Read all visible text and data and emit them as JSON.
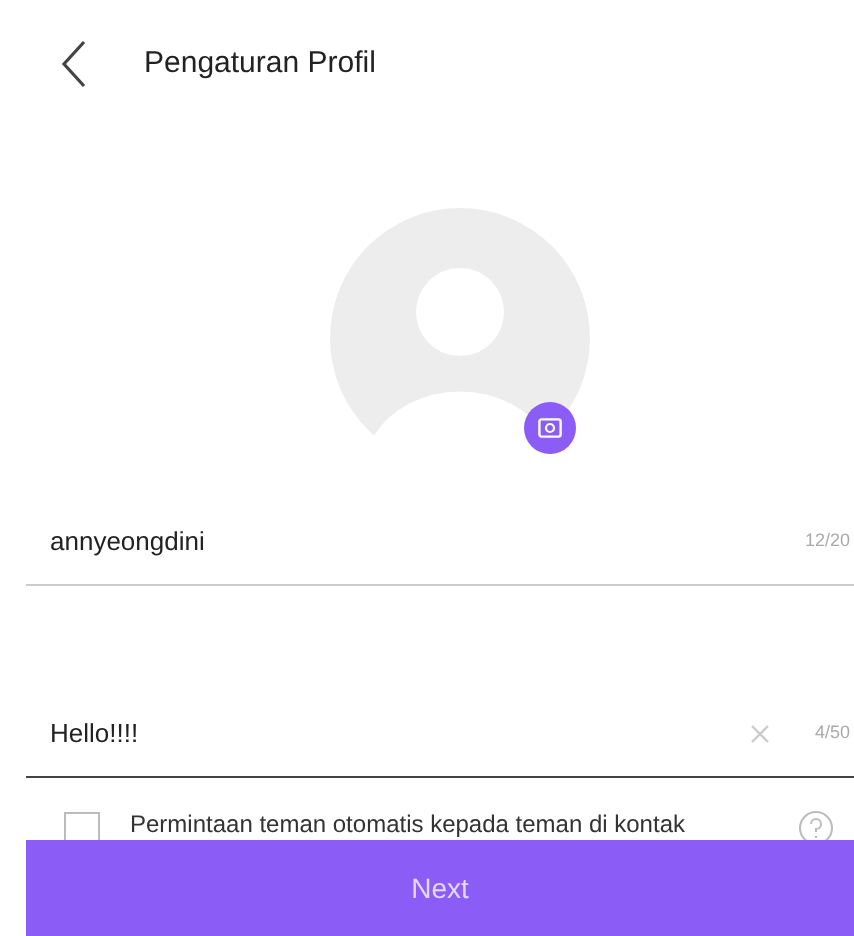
{
  "header": {
    "title": "Pengaturan Profil"
  },
  "fields": [
    {
      "value": "annyeongdini",
      "counter": "12/20",
      "clearable": false,
      "focused": false
    },
    {
      "value": "Hello!!!!",
      "counter": "4/50",
      "clearable": true,
      "focused": true
    }
  ],
  "option": {
    "label": "Permintaan teman otomatis kepada teman di kontak",
    "checked": false
  },
  "next_button": {
    "label": "Next"
  }
}
